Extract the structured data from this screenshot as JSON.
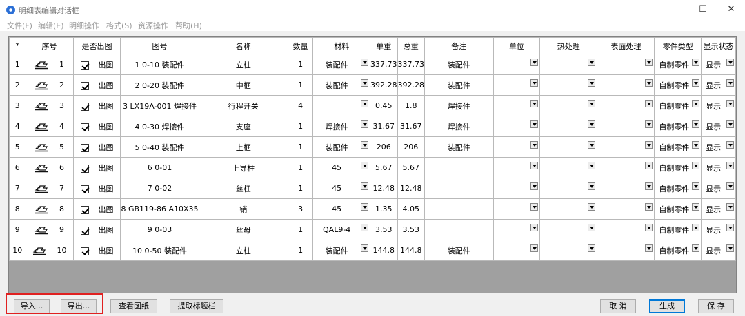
{
  "window": {
    "title": "明细表编辑对话框"
  },
  "menu": [
    "文件(F)",
    "编辑(E)",
    "明细操作",
    "格式(S)",
    "资源操作",
    "帮助(H)"
  ],
  "columns": [
    "*",
    "序号",
    "是否出图",
    "图号",
    "名称",
    "数量",
    "材料",
    "单重",
    "总重",
    "备注",
    "单位",
    "热处理",
    "表面处理",
    "零件类型",
    "显示状态"
  ],
  "rows": [
    {
      "idx": "1",
      "seq": "1",
      "checked": true,
      "out": "出图",
      "code": "1 0-10 装配件",
      "name": "立柱",
      "qty": "1",
      "material": "装配件",
      "unit_w": "337.73",
      "total_w": "337.73",
      "note": "装配件",
      "unit": "",
      "heat": "",
      "surface": "",
      "ptype": "自制零件",
      "state": "显示"
    },
    {
      "idx": "2",
      "seq": "2",
      "checked": true,
      "out": "出图",
      "code": "2 0-20 装配件",
      "name": "中框",
      "qty": "1",
      "material": "装配件",
      "unit_w": "392.28",
      "total_w": "392.28",
      "note": "装配件",
      "unit": "",
      "heat": "",
      "surface": "",
      "ptype": "自制零件",
      "state": "显示"
    },
    {
      "idx": "3",
      "seq": "3",
      "checked": true,
      "out": "出图",
      "code": "3 LX19A-001 焊接件",
      "name": "行程开关",
      "qty": "4",
      "material": "",
      "unit_w": "0.45",
      "total_w": "1.8",
      "note": "焊接件",
      "unit": "",
      "heat": "",
      "surface": "",
      "ptype": "自制零件",
      "state": "显示"
    },
    {
      "idx": "4",
      "seq": "4",
      "checked": true,
      "out": "出图",
      "code": "4 0-30 焊接件",
      "name": "支座",
      "qty": "1",
      "material": "焊接件",
      "unit_w": "31.67",
      "total_w": "31.67",
      "note": "焊接件",
      "unit": "",
      "heat": "",
      "surface": "",
      "ptype": "自制零件",
      "state": "显示"
    },
    {
      "idx": "5",
      "seq": "5",
      "checked": true,
      "out": "出图",
      "code": "5 0-40 装配件",
      "name": "上框",
      "qty": "1",
      "material": "装配件",
      "unit_w": "206",
      "total_w": "206",
      "note": "装配件",
      "unit": "",
      "heat": "",
      "surface": "",
      "ptype": "自制零件",
      "state": "显示"
    },
    {
      "idx": "6",
      "seq": "6",
      "checked": true,
      "out": "出图",
      "code": "6 0-01",
      "name": "上导柱",
      "qty": "1",
      "material": "45",
      "unit_w": "5.67",
      "total_w": "5.67",
      "note": "",
      "unit": "",
      "heat": "",
      "surface": "",
      "ptype": "自制零件",
      "state": "显示"
    },
    {
      "idx": "7",
      "seq": "7",
      "checked": true,
      "out": "出图",
      "code": "7 0-02",
      "name": "丝杠",
      "qty": "1",
      "material": "45",
      "unit_w": "12.48",
      "total_w": "12.48",
      "note": "",
      "unit": "",
      "heat": "",
      "surface": "",
      "ptype": "自制零件",
      "state": "显示"
    },
    {
      "idx": "8",
      "seq": "8",
      "checked": true,
      "out": "出图",
      "code": "8 GB119-86 A10X35",
      "name": "销",
      "qty": "3",
      "material": "45",
      "unit_w": "1.35",
      "total_w": "4.05",
      "note": "",
      "unit": "",
      "heat": "",
      "surface": "",
      "ptype": "自制零件",
      "state": "显示"
    },
    {
      "idx": "9",
      "seq": "9",
      "checked": true,
      "out": "出图",
      "code": "9 0-03",
      "name": "丝母",
      "qty": "1",
      "material": "QAL9-4",
      "unit_w": "3.53",
      "total_w": "3.53",
      "note": "",
      "unit": "",
      "heat": "",
      "surface": "",
      "ptype": "自制零件",
      "state": "显示"
    },
    {
      "idx": "10",
      "seq": "10",
      "checked": true,
      "out": "出图",
      "code": "10 0-50 装配件",
      "name": "立柱",
      "qty": "1",
      "material": "装配件",
      "unit_w": "144.8",
      "total_w": "144.8",
      "note": "装配件",
      "unit": "",
      "heat": "",
      "surface": "",
      "ptype": "自制零件",
      "state": "显示"
    }
  ],
  "buttons": {
    "import": "导入...",
    "export": "导出...",
    "view_drawing": "查看图纸",
    "extract_title": "提取标题栏",
    "cancel": "取 消",
    "generate": "生成",
    "save": "保 存"
  }
}
